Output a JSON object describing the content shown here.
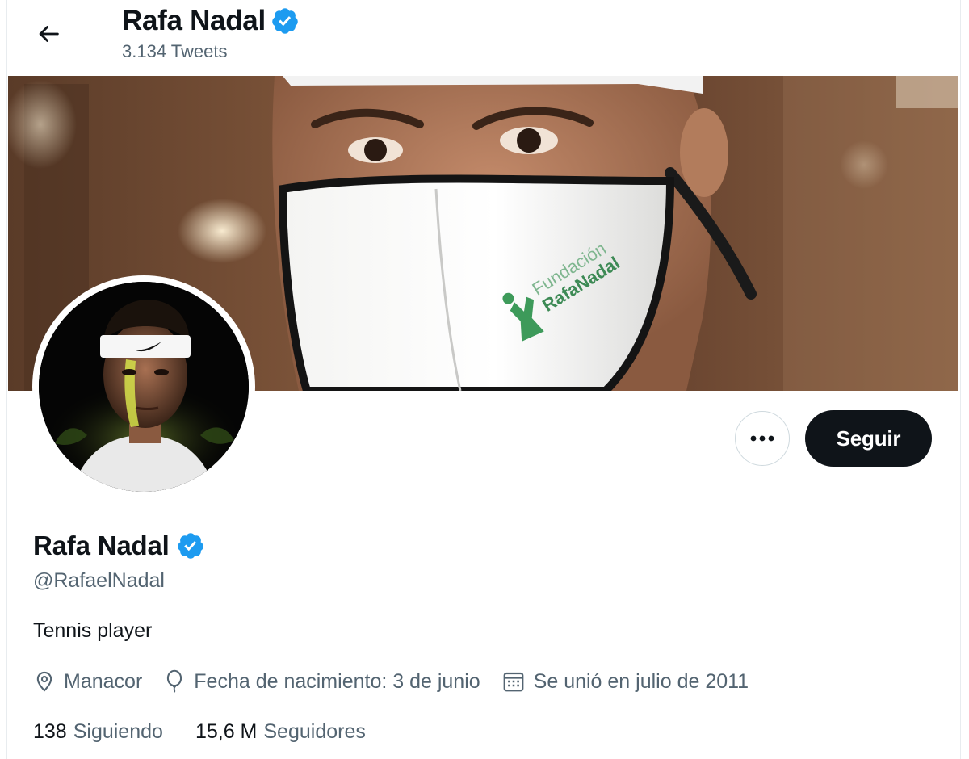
{
  "header": {
    "name": "Rafa Nadal",
    "tweet_count": "3.134 Tweets"
  },
  "profile": {
    "name": "Rafa Nadal",
    "handle": "@RafaelNadal",
    "bio": "Tennis player",
    "location": "Manacor",
    "birthday": "Fecha de nacimiento: 3 de junio",
    "joined": "Se unió en julio de 2011"
  },
  "actions": {
    "more_label": "•••",
    "follow_label": "Seguir"
  },
  "stats": {
    "following_count": "138",
    "following_label": "Siguiendo",
    "followers_count": "15,6 M",
    "followers_label": "Seguidores"
  },
  "banner": {
    "mask_text_line1": "Fundación",
    "mask_text_line2": "RafaNadal"
  },
  "colors": {
    "verified_blue": "#1d9bf0",
    "text_primary": "#0f1419",
    "text_secondary": "#536471",
    "follow_button_bg": "#0f1419"
  }
}
